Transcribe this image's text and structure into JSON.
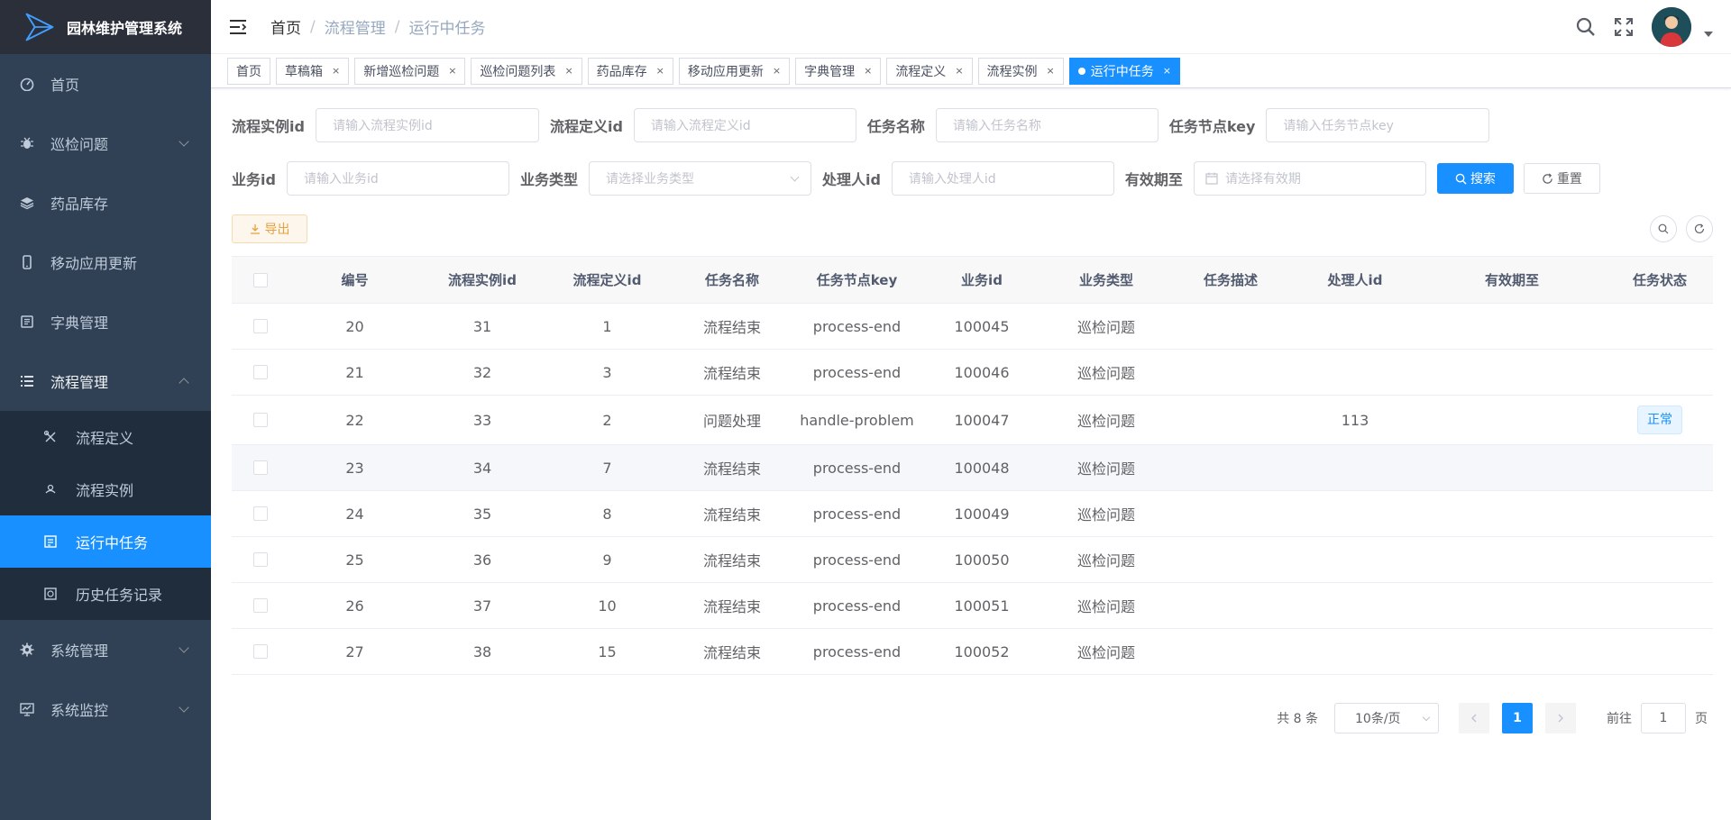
{
  "app": {
    "title": "园林维护管理系统"
  },
  "sidebar": {
    "items": [
      {
        "label": "首页",
        "icon": "dashboard-icon"
      },
      {
        "label": "巡检问题",
        "icon": "bug-icon"
      },
      {
        "label": "药品库存",
        "icon": "layers-icon"
      },
      {
        "label": "移动应用更新",
        "icon": "phone-icon"
      },
      {
        "label": "字典管理",
        "icon": "dict-icon"
      },
      {
        "label": "流程管理",
        "icon": "list-icon"
      }
    ],
    "submenu": [
      {
        "label": "流程定义",
        "icon": "tools-icon"
      },
      {
        "label": "流程实例",
        "icon": "people-icon"
      },
      {
        "label": "运行中任务",
        "icon": "form-icon",
        "active": true
      },
      {
        "label": "历史任务记录",
        "icon": "record-icon"
      }
    ],
    "bottom": [
      {
        "label": "系统管理",
        "icon": "gear-icon"
      },
      {
        "label": "系统监控",
        "icon": "monitor-icon"
      }
    ]
  },
  "breadcrumb": [
    "首页",
    "流程管理",
    "运行中任务"
  ],
  "tags": [
    {
      "label": "首页",
      "closable": false
    },
    {
      "label": "草稿箱",
      "closable": true
    },
    {
      "label": "新增巡检问题",
      "closable": true
    },
    {
      "label": "巡检问题列表",
      "closable": true
    },
    {
      "label": "药品库存",
      "closable": true
    },
    {
      "label": "移动应用更新",
      "closable": true
    },
    {
      "label": "字典管理",
      "closable": true
    },
    {
      "label": "流程定义",
      "closable": true
    },
    {
      "label": "流程实例",
      "closable": true
    },
    {
      "label": "运行中任务",
      "closable": true,
      "active": true
    }
  ],
  "form": {
    "instance_id": {
      "label": "流程实例id",
      "placeholder": "请输入流程实例id"
    },
    "definition_id": {
      "label": "流程定义id",
      "placeholder": "请输入流程定义id"
    },
    "task_name": {
      "label": "任务名称",
      "placeholder": "请输入任务名称"
    },
    "task_key": {
      "label": "任务节点key",
      "placeholder": "请输入任务节点key"
    },
    "biz_id": {
      "label": "业务id",
      "placeholder": "请输入业务id"
    },
    "biz_type": {
      "label": "业务类型",
      "placeholder": "请选择业务类型"
    },
    "assignee": {
      "label": "处理人id",
      "placeholder": "请输入处理人id"
    },
    "expire": {
      "label": "有效期至",
      "placeholder": "请选择有效期"
    },
    "search_label": "搜索",
    "reset_label": "重置",
    "export_label": "导出"
  },
  "table": {
    "columns": [
      "编号",
      "流程实例id",
      "流程定义id",
      "任务名称",
      "任务节点key",
      "业务id",
      "业务类型",
      "任务描述",
      "处理人id",
      "有效期至",
      "任务状态"
    ],
    "rows": [
      [
        "20",
        "31",
        "1",
        "流程结束",
        "process-end",
        "100045",
        "巡检问题",
        "",
        "",
        "",
        ""
      ],
      [
        "21",
        "32",
        "3",
        "流程结束",
        "process-end",
        "100046",
        "巡检问题",
        "",
        "",
        "",
        ""
      ],
      [
        "22",
        "33",
        "2",
        "问题处理",
        "handle-problem",
        "100047",
        "巡检问题",
        "",
        "113",
        "",
        "正常"
      ],
      [
        "23",
        "34",
        "7",
        "流程结束",
        "process-end",
        "100048",
        "巡检问题",
        "",
        "",
        "",
        ""
      ],
      [
        "24",
        "35",
        "8",
        "流程结束",
        "process-end",
        "100049",
        "巡检问题",
        "",
        "",
        "",
        ""
      ],
      [
        "25",
        "36",
        "9",
        "流程结束",
        "process-end",
        "100050",
        "巡检问题",
        "",
        "",
        "",
        ""
      ],
      [
        "26",
        "37",
        "10",
        "流程结束",
        "process-end",
        "100051",
        "巡检问题",
        "",
        "",
        "",
        ""
      ],
      [
        "27",
        "38",
        "15",
        "流程结束",
        "process-end",
        "100052",
        "巡检问题",
        "",
        "",
        "",
        ""
      ]
    ]
  },
  "pagination": {
    "total": "共 8 条",
    "page_size": "10条/页",
    "current": "1",
    "goto_prefix": "前往",
    "goto_value": "1",
    "goto_suffix": "页"
  },
  "colors": {
    "sidebar_bg": "#304156",
    "submenu_bg": "#1f2d3d",
    "accent": "#1890ff",
    "warning": "#e6a23c"
  }
}
